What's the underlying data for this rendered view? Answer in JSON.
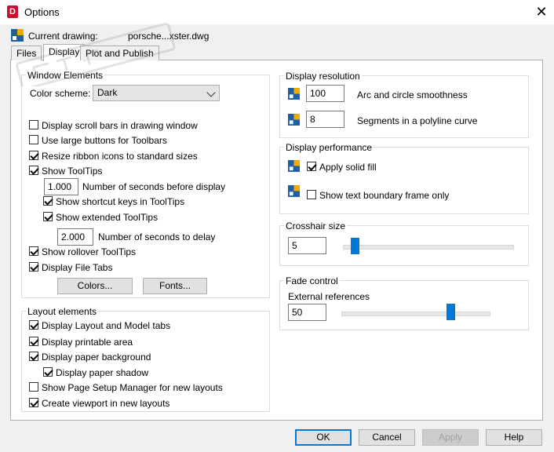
{
  "window": {
    "title": "Options",
    "app_icon_letter": "D",
    "close_glyph": "✕"
  },
  "current_drawing": {
    "label": "Current drawing:",
    "value": "porsche...xster.dwg"
  },
  "tabs": [
    {
      "label": "Files",
      "active": false
    },
    {
      "label": "Display",
      "active": true
    },
    {
      "label": "Plot and Publish",
      "active": false
    }
  ],
  "window_elements": {
    "title": "Window Elements",
    "color_scheme_label": "Color scheme:",
    "color_scheme_value": "Dark",
    "scroll_bars": "Display scroll bars in drawing window",
    "large_buttons": "Use large buttons for Toolbars",
    "resize_ribbon": "Resize ribbon icons to standard sizes",
    "show_tooltips": "Show ToolTips",
    "tooltip_seconds_value": "1.000",
    "tooltip_seconds_label": "Number of seconds before display",
    "shortcut_keys": "Show shortcut keys in ToolTips",
    "extended_tooltips": "Show extended ToolTips",
    "delay_value": "2.000",
    "delay_label": "Number of seconds to delay",
    "rollover_tooltips": "Show rollover ToolTips",
    "file_tabs": "Display File Tabs",
    "colors_button": "Colors...",
    "fonts_button": "Fonts..."
  },
  "checkbox_states": {
    "scroll_bars": false,
    "large_buttons": false,
    "resize_ribbon": true,
    "show_tooltips": true,
    "shortcut_keys": true,
    "extended_tooltips": true,
    "rollover_tooltips": true,
    "file_tabs": true,
    "layout_model_tabs": true,
    "printable_area": true,
    "paper_background": true,
    "paper_shadow": true,
    "page_setup_manager": false,
    "create_viewport": true,
    "solid_fill": true,
    "text_boundary": false
  },
  "layout_elements": {
    "title": "Layout elements",
    "layout_model_tabs": "Display Layout and Model tabs",
    "printable_area": "Display printable area",
    "paper_background": "Display paper background",
    "paper_shadow": "Display paper shadow",
    "page_setup_manager": "Show Page Setup Manager for new layouts",
    "create_viewport": "Create viewport in new layouts"
  },
  "display_resolution": {
    "title": "Display resolution",
    "arc_value": "100",
    "arc_label": "Arc and circle smoothness",
    "segments_value": "8",
    "segments_label": "Segments in a polyline curve"
  },
  "display_performance": {
    "title": "Display performance",
    "solid_fill": "Apply solid fill",
    "text_boundary": "Show text boundary frame only"
  },
  "crosshair": {
    "title": "Crosshair size",
    "value": "5",
    "slider_fraction": 0.05
  },
  "fade_control": {
    "title": "Fade control",
    "external_label": "External references",
    "value": "50",
    "slider_fraction": 0.75
  },
  "buttons": {
    "ok": "OK",
    "cancel": "Cancel",
    "apply": "Apply",
    "help": "Help"
  },
  "colors": {
    "accent": "#0078d7",
    "app_red": "#c8102e",
    "dialog_bg": "#f0f0f0"
  }
}
